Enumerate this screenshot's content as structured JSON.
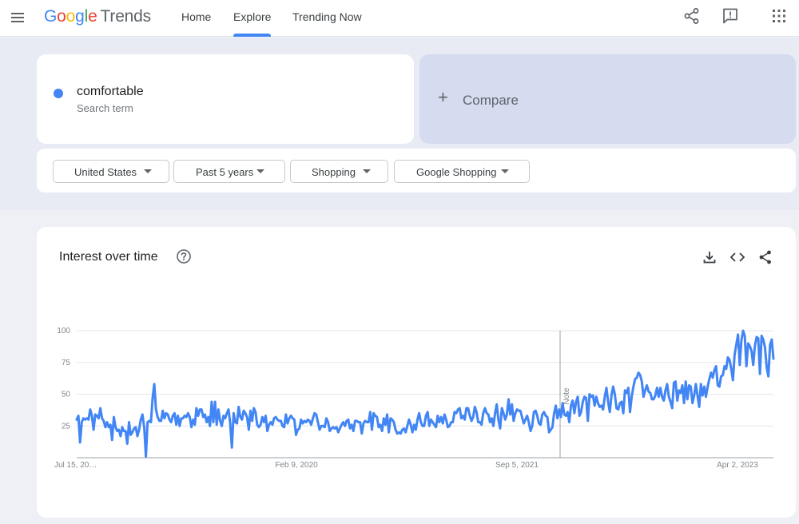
{
  "header": {
    "logo_google": "Google",
    "logo_trends": "Trends",
    "nav": [
      {
        "label": "Home"
      },
      {
        "label": "Explore"
      },
      {
        "label": "Trending Now"
      }
    ],
    "active_nav": "Explore",
    "icons": [
      "menu-icon",
      "share-icon",
      "feedback-icon",
      "apps-icon"
    ]
  },
  "search": {
    "term": "comfortable",
    "term_sub": "Search term",
    "term_color": "#4285f4",
    "compare_label": "Compare"
  },
  "filters": [
    {
      "label": "United States"
    },
    {
      "label": "Past 5 years"
    },
    {
      "label": "Shopping"
    },
    {
      "label": "Google Shopping"
    }
  ],
  "chart_card": {
    "title": "Interest over time",
    "icons": [
      "help-icon",
      "download-icon",
      "embed-icon",
      "share-icon"
    ]
  },
  "chart_data": {
    "type": "line",
    "x_tick_labels": [
      "Jul 15, 20…",
      "Feb 9, 2020",
      "Sep 5, 2021",
      "Apr 2, 2023"
    ],
    "y_tick_labels": [
      "100",
      "75",
      "50",
      "25"
    ],
    "ylim": [
      0,
      100
    ],
    "annotation": "Note",
    "series_color": "#4285f4",
    "series": [
      {
        "values": [
          30,
          33,
          12,
          28,
          31,
          30,
          31,
          30,
          38,
          33,
          22,
          34,
          33,
          31,
          39,
          31,
          29,
          24,
          28,
          24,
          26,
          14,
          32,
          24,
          21,
          22,
          17,
          24,
          21,
          21,
          11,
          28,
          18,
          20,
          23,
          24,
          17,
          22,
          30,
          34,
          24,
          1,
          28,
          29,
          28,
          47,
          58,
          38,
          32,
          29,
          29,
          37,
          31,
          35,
          34,
          30,
          28,
          33,
          35,
          26,
          33,
          25,
          31,
          31,
          33,
          32,
          35,
          32,
          24,
          30,
          26,
          39,
          33,
          38,
          38,
          32,
          34,
          28,
          32,
          25,
          44,
          28,
          44,
          26,
          38,
          29,
          25,
          33,
          31,
          35,
          38,
          27,
          8,
          35,
          28,
          27,
          40,
          32,
          30,
          37,
          35,
          32,
          22,
          37,
          29,
          39,
          36,
          26,
          24,
          26,
          32,
          28,
          33,
          21,
          26,
          28,
          26,
          31,
          32,
          30,
          29,
          29,
          25,
          24,
          34,
          27,
          31,
          33,
          31,
          30,
          18,
          22,
          23,
          30,
          27,
          29,
          28,
          30,
          29,
          26,
          31,
          35,
          34,
          28,
          22,
          25,
          25,
          24,
          31,
          28,
          21,
          23,
          24,
          23,
          24,
          20,
          23,
          26,
          28,
          25,
          29,
          30,
          23,
          26,
          21,
          29,
          29,
          28,
          28,
          19,
          27,
          29,
          28,
          28,
          36,
          22,
          35,
          33,
          32,
          24,
          26,
          21,
          31,
          26,
          34,
          20,
          31,
          30,
          28,
          22,
          19,
          20,
          19,
          22,
          23,
          20,
          25,
          30,
          26,
          20,
          26,
          22,
          30,
          35,
          28,
          25,
          25,
          33,
          36,
          25,
          30,
          28,
          26,
          24,
          33,
          28,
          32,
          27,
          34,
          30,
          24,
          25,
          28,
          28,
          36,
          35,
          38,
          39,
          31,
          33,
          30,
          39,
          39,
          33,
          29,
          32,
          40,
          36,
          28,
          28,
          26,
          35,
          39,
          35,
          34,
          28,
          31,
          25,
          35,
          42,
          30,
          23,
          39,
          35,
          30,
          34,
          46,
          34,
          42,
          29,
          35,
          38,
          37,
          37,
          32,
          27,
          30,
          33,
          28,
          21,
          25,
          36,
          37,
          33,
          27,
          26,
          34,
          36,
          33,
          32,
          20,
          22,
          24,
          35,
          41,
          31,
          38,
          32,
          43,
          34,
          33,
          36,
          28,
          41,
          45,
          35,
          44,
          48,
          33,
          36,
          44,
          48,
          47,
          29,
          50,
          48,
          49,
          41,
          48,
          43,
          40,
          41,
          38,
          48,
          55,
          44,
          36,
          49,
          56,
          50,
          39,
          38,
          43,
          44,
          35,
          53,
          51,
          55,
          36,
          48,
          56,
          62,
          63,
          67,
          65,
          60,
          48,
          53,
          57,
          52,
          51,
          46,
          46,
          49,
          55,
          48,
          55,
          48,
          45,
          53,
          58,
          48,
          44,
          39,
          59,
          60,
          45,
          53,
          51,
          57,
          43,
          60,
          46,
          57,
          56,
          43,
          49,
          58,
          49,
          40,
          58,
          49,
          56,
          48,
          56,
          62,
          67,
          63,
          69,
          72,
          57,
          56,
          64,
          65,
          72,
          70,
          79,
          77,
          70,
          61,
          81,
          89,
          97,
          73,
          92,
          100,
          96,
          72,
          90,
          88,
          84,
          73,
          88,
          95,
          94,
          66,
          96,
          93,
          87,
          71,
          64,
          89,
          93,
          78
        ]
      }
    ]
  }
}
